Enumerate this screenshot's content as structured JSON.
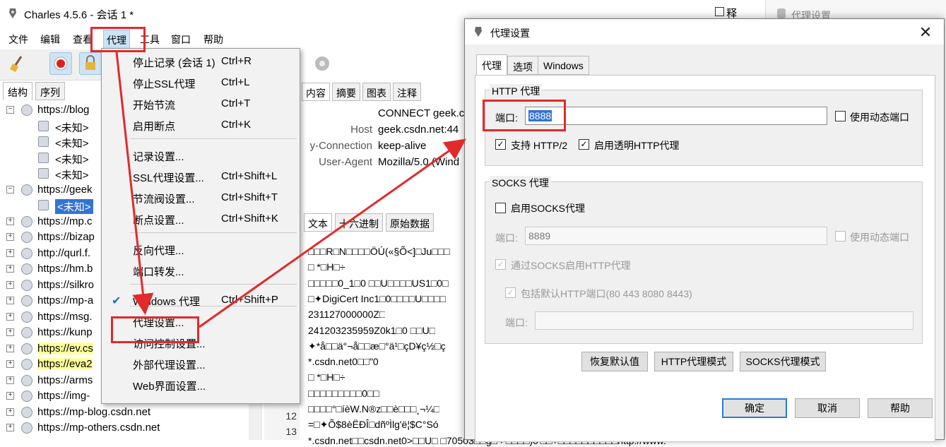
{
  "main": {
    "title": "Charles 4.5.6 - 会话 1 *",
    "menu": [
      "文件",
      "编辑",
      "查看",
      "代理",
      "工具",
      "窗口",
      "帮助"
    ],
    "partial_right": "释",
    "left_tabs": [
      "结构",
      "序列"
    ],
    "tree": [
      {
        "label": "https://blog",
        "expand": "−"
      },
      {
        "label": "<未知>",
        "child": true
      },
      {
        "label": "<未知>",
        "child": true
      },
      {
        "label": "<未知>",
        "child": true
      },
      {
        "label": "<未知>",
        "child": true
      },
      {
        "label": "https://geek",
        "expand": "−"
      },
      {
        "label": "<未知>",
        "child": true,
        "selected": true
      },
      {
        "label": "https://mp.c",
        "expand": "+"
      },
      {
        "label": "https://bizap",
        "expand": "+"
      },
      {
        "label": "http://qurl.f.",
        "expand": "+"
      },
      {
        "label": "https://hm.b",
        "expand": "+"
      },
      {
        "label": "https://silkro",
        "expand": "+"
      },
      {
        "label": "https://mp-a",
        "expand": "+"
      },
      {
        "label": "https://msg.",
        "expand": "+"
      },
      {
        "label": "https://kunp",
        "expand": "+"
      },
      {
        "label": "https://ev.cs",
        "expand": "+",
        "highlight": true
      },
      {
        "label": "https://eva2",
        "expand": "+",
        "highlight": true
      },
      {
        "label": "https://arms",
        "expand": "+"
      },
      {
        "label": "https://img-",
        "expand": "+"
      },
      {
        "label": "https://mp-blog.csdn.net",
        "expand": "+"
      },
      {
        "label": "https://mp-others.csdn.net",
        "expand": "+"
      }
    ],
    "right_tabs": [
      "内容",
      "摘要",
      "图表",
      "注释"
    ],
    "headers": [
      {
        "k": "",
        "v": "CONNECT geek.c"
      },
      {
        "k": "Host",
        "v": "geek.csdn.net:44"
      },
      {
        "k": "y-Connection",
        "v": "keep-alive"
      },
      {
        "k": "User-Agent",
        "v": "Mozilla/5.0 (Wind"
      }
    ],
    "body_tabs": [
      "文本",
      "十六进制",
      "原始数据"
    ],
    "data_lines": [
      "□□□R□N□□□□ÖÚ(«§Õ<]□Ju□□□",
      "□             *□H□÷",
      "□□□□□0_1□0  □□U□□□□US1□0□",
      "□✦DigiCert Inc1□0□□□□U□□□□",
      "231127000000Z□",
      "241203235959Z0k1□0     □□U□",
      "✦*å□□ä°¬å□□æ□°ä¹□çD¥ç½□ç",
      "*.csdn.net0□□\"0",
      "□             *□H□÷",
      "□□□□□□□□□0□□",
      "□□□□°□íèW.N®z□□è□□□¸¬¼□",
      "=□✦Õ$8èËÐÎ□dñºÌlg'ë¦$C°Só",
      "*.csdn.net□□csdn.net0>□□U□ □70503□□g□✦□□□□)0'□□+□□□□□□□□□□http://www."
    ],
    "line_numbers": [
      "12",
      "13"
    ]
  },
  "dropdown": {
    "items": [
      {
        "label": "停止记录 (会话 1)",
        "shortcut": "Ctrl+R"
      },
      {
        "label": "停止SSL代理",
        "shortcut": "Ctrl+L"
      },
      {
        "label": "开始节流",
        "shortcut": "Ctrl+T"
      },
      {
        "label": "启用断点",
        "shortcut": "Ctrl+K"
      },
      {
        "label": "记录设置...",
        "shortcut": ""
      },
      {
        "label": "SSL代理设置...",
        "shortcut": "Ctrl+Shift+L"
      },
      {
        "label": "节流阀设置...",
        "shortcut": "Ctrl+Shift+T"
      },
      {
        "label": "断点设置...",
        "shortcut": "Ctrl+Shift+K"
      },
      {
        "label": "反向代理...",
        "shortcut": ""
      },
      {
        "label": "端口转发...",
        "shortcut": ""
      },
      {
        "label": "Windows 代理",
        "shortcut": "Ctrl+Shift+P",
        "checked": true
      },
      {
        "label": "代理设置...",
        "shortcut": ""
      },
      {
        "label": "访问控制设置...",
        "shortcut": ""
      },
      {
        "label": "外部代理设置...",
        "shortcut": ""
      },
      {
        "label": "Web界面设置...",
        "shortcut": ""
      }
    ]
  },
  "dialog": {
    "title": "代理设置",
    "tabs": [
      "代理",
      "选项",
      "Windows"
    ],
    "http_group": "HTTP 代理",
    "port_label": "端口:",
    "port_value": "8888",
    "dynamic_port": "使用动态端口",
    "http2": "支持 HTTP/2",
    "transparent": "启用透明HTTP代理",
    "socks_group": "SOCKS 代理",
    "enable_socks": "启用SOCKS代理",
    "socks_port_label": "端口:",
    "socks_port_value": "8889",
    "socks_dynamic": "使用动态端口",
    "socks_http": "通过SOCKS启用HTTP代理",
    "include_default": "包括默认HTTP端口(80 443 8080 8443)",
    "socks_ports_label": "端口:",
    "restore": "恢复默认值",
    "http_mode": "HTTP代理模式",
    "socks_mode": "SOCKS代理模式",
    "ok": "确定",
    "cancel": "取消",
    "help": "帮助"
  },
  "background_window": {
    "title": "代理设置"
  },
  "colors": {
    "annotation_red": "#e12a2a",
    "selection_blue": "#3373d2",
    "highlight_yellow": "#ffff99"
  }
}
